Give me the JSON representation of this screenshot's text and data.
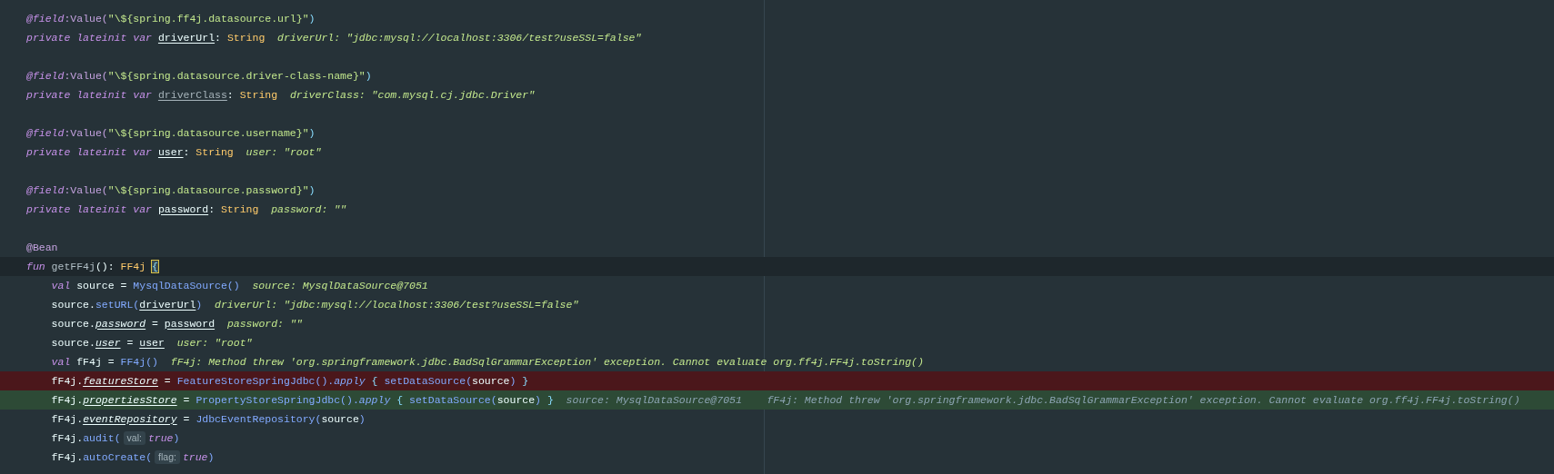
{
  "editor": {
    "lines": [
      {
        "kind": "code",
        "tokens": [
          {
            "kind": "ann_i",
            "text": "@field"
          },
          {
            "kind": "ann",
            "text": ":Value("
          },
          {
            "kind": "str",
            "text": "\"\\${spring.ff4j.datasource.url}\""
          },
          {
            "kind": "punct",
            "text": ")"
          }
        ]
      },
      {
        "kind": "code",
        "tokens": [
          {
            "kind": "kw",
            "text": "private lateinit var "
          },
          {
            "kind": "prop",
            "text": "driverUrl"
          },
          {
            "kind": "plain",
            "text": ": "
          },
          {
            "kind": "type",
            "text": "String"
          },
          {
            "kind": "debug",
            "text": "driverUrl: \"jdbc:mysql://localhost:3306/test?useSSL=false\""
          }
        ]
      },
      {
        "kind": "code"
      },
      {
        "kind": "code",
        "tokens": [
          {
            "kind": "ann_i",
            "text": "@field"
          },
          {
            "kind": "ann",
            "text": ":Value("
          },
          {
            "kind": "str",
            "text": "\"\\${spring.datasource.driver-class-name}\""
          },
          {
            "kind": "punct",
            "text": ")"
          }
        ]
      },
      {
        "kind": "code",
        "tokens": [
          {
            "kind": "kw",
            "text": "private lateinit var "
          },
          {
            "kind": "prop_dim",
            "text": "driverClass"
          },
          {
            "kind": "plain",
            "text": ": "
          },
          {
            "kind": "type",
            "text": "String"
          },
          {
            "kind": "debug",
            "text": "driverClass: \"com.mysql.cj.jdbc.Driver\""
          }
        ]
      },
      {
        "kind": "code"
      },
      {
        "kind": "code",
        "tokens": [
          {
            "kind": "ann_i",
            "text": "@field"
          },
          {
            "kind": "ann",
            "text": ":Value("
          },
          {
            "kind": "str",
            "text": "\"\\${spring.datasource.username}\""
          },
          {
            "kind": "punct",
            "text": ")"
          }
        ]
      },
      {
        "kind": "code",
        "tokens": [
          {
            "kind": "kw",
            "text": "private lateinit var "
          },
          {
            "kind": "prop",
            "text": "user"
          },
          {
            "kind": "plain",
            "text": ": "
          },
          {
            "kind": "type",
            "text": "String"
          },
          {
            "kind": "debug",
            "text": "user: \"root\""
          }
        ]
      },
      {
        "kind": "code"
      },
      {
        "kind": "code",
        "tokens": [
          {
            "kind": "ann_i",
            "text": "@field"
          },
          {
            "kind": "ann",
            "text": ":Value("
          },
          {
            "kind": "str",
            "text": "\"\\${spring.datasource.password}\""
          },
          {
            "kind": "punct",
            "text": ")"
          }
        ]
      },
      {
        "kind": "code",
        "tokens": [
          {
            "kind": "kw",
            "text": "private lateinit var "
          },
          {
            "kind": "prop",
            "text": "password"
          },
          {
            "kind": "plain",
            "text": ": "
          },
          {
            "kind": "type",
            "text": "String"
          },
          {
            "kind": "debug",
            "text": "password: \"\""
          }
        ]
      },
      {
        "kind": "code"
      },
      {
        "kind": "code",
        "tokens": [
          {
            "kind": "ann",
            "text": "@Bean"
          }
        ]
      },
      {
        "kind": "caret_line",
        "tokens": [
          {
            "kind": "kw",
            "text": "fun "
          },
          {
            "kind": "plain_dim",
            "text": "getFF4j"
          },
          {
            "kind": "plain",
            "text": "(): "
          },
          {
            "kind": "type",
            "text": "FF4j "
          },
          {
            "kind": "brace_match",
            "text": "{"
          }
        ]
      },
      {
        "kind": "code",
        "tokens": [
          {
            "kind": "kw",
            "text": "    val "
          },
          {
            "kind": "plain",
            "text": "source = "
          },
          {
            "kind": "fn",
            "text": "MysqlDataSource()"
          },
          {
            "kind": "debug",
            "text": "source: MysqlDataSource@7051"
          }
        ]
      },
      {
        "kind": "code",
        "tokens": [
          {
            "kind": "plain",
            "text": "    source."
          },
          {
            "kind": "fn",
            "text": "setURL("
          },
          {
            "kind": "prop",
            "text": "driverUrl"
          },
          {
            "kind": "fn",
            "text": ")"
          },
          {
            "kind": "debug",
            "text": "driverUrl: \"jdbc:mysql://localhost:3306/test?useSSL=false\""
          }
        ]
      },
      {
        "kind": "code",
        "tokens": [
          {
            "kind": "plain",
            "text": "    source."
          },
          {
            "kind": "prop_i",
            "text": "password"
          },
          {
            "kind": "plain",
            "text": " = "
          },
          {
            "kind": "prop",
            "text": "password"
          },
          {
            "kind": "debug",
            "text": "password: \"\""
          }
        ]
      },
      {
        "kind": "code",
        "tokens": [
          {
            "kind": "plain",
            "text": "    source."
          },
          {
            "kind": "prop_i",
            "text": "user"
          },
          {
            "kind": "plain",
            "text": " = "
          },
          {
            "kind": "prop",
            "text": "user"
          },
          {
            "kind": "debug",
            "text": "user: \"root\""
          }
        ]
      },
      {
        "kind": "code",
        "tokens": [
          {
            "kind": "kw",
            "text": "    val "
          },
          {
            "kind": "plain",
            "text": "fF4j = "
          },
          {
            "kind": "fn",
            "text": "FF4j()"
          },
          {
            "kind": "debug",
            "text": "fF4j: Method threw 'org.springframework.jdbc.BadSqlGrammarException' exception. Cannot evaluate org.ff4j.FF4j.toString()"
          }
        ]
      },
      {
        "kind": "breakpoint",
        "tokens": [
          {
            "kind": "plain",
            "text": "    fF4j."
          },
          {
            "kind": "prop_i",
            "text": "featureStore"
          },
          {
            "kind": "plain",
            "text": " = "
          },
          {
            "kind": "fn",
            "text": "FeatureStoreSpringJdbc()."
          },
          {
            "kind": "fn_i",
            "text": "apply"
          },
          {
            "kind": "punct",
            "text": " { "
          },
          {
            "kind": "fn",
            "text": "setDataSource("
          },
          {
            "kind": "plain",
            "text": "source"
          },
          {
            "kind": "fn",
            "text": ")"
          },
          {
            "kind": "punct",
            "text": " }"
          }
        ]
      },
      {
        "kind": "execution_point",
        "tokens": [
          {
            "kind": "plain",
            "text": "    fF4j."
          },
          {
            "kind": "prop_i",
            "text": "propertiesStore"
          },
          {
            "kind": "plain",
            "text": " = "
          },
          {
            "kind": "fn",
            "text": "PropertyStoreSpringJdbc()."
          },
          {
            "kind": "fn_i",
            "text": "apply"
          },
          {
            "kind": "punct",
            "text": " { "
          },
          {
            "kind": "fn",
            "text": "setDataSource("
          },
          {
            "kind": "plain",
            "text": "source"
          },
          {
            "kind": "fn",
            "text": ")"
          },
          {
            "kind": "punct",
            "text": " }"
          },
          {
            "kind": "debug_dim",
            "text": "source: MysqlDataSource@7051"
          },
          {
            "kind": "debug_dim",
            "text": "fF4j: Method threw 'org.springframework.jdbc.BadSqlGrammarException' exception. Cannot evaluate org.ff4j.FF4j.toString()"
          }
        ]
      },
      {
        "kind": "code",
        "tokens": [
          {
            "kind": "plain",
            "text": "    fF4j."
          },
          {
            "kind": "prop_i",
            "text": "eventRepository"
          },
          {
            "kind": "plain",
            "text": " = "
          },
          {
            "kind": "fn",
            "text": "JdbcEventRepository("
          },
          {
            "kind": "plain",
            "text": "source"
          },
          {
            "kind": "fn",
            "text": ")"
          }
        ]
      },
      {
        "kind": "code",
        "tokens": [
          {
            "kind": "plain",
            "text": "    fF4j."
          },
          {
            "kind": "fn",
            "text": "audit("
          },
          {
            "kind": "hint",
            "text": "val:"
          },
          {
            "kind": "kw",
            "text": "true"
          },
          {
            "kind": "fn",
            "text": ")"
          }
        ]
      },
      {
        "kind": "code",
        "tokens": [
          {
            "kind": "plain",
            "text": "    fF4j."
          },
          {
            "kind": "fn",
            "text": "autoCreate("
          },
          {
            "kind": "hint",
            "text": "flag:"
          },
          {
            "kind": "kw",
            "text": "true"
          },
          {
            "kind": "fn",
            "text": ")"
          }
        ]
      }
    ]
  }
}
